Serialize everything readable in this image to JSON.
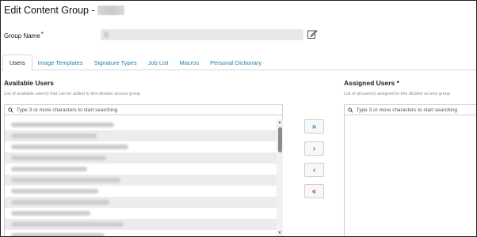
{
  "header": {
    "title": "Edit Content Group -"
  },
  "group_name": {
    "label": "Group Name",
    "required_mark": "*",
    "value": ""
  },
  "tabs": [
    {
      "label": "Users",
      "active": true
    },
    {
      "label": "Image Templates",
      "active": false
    },
    {
      "label": "Signature Types",
      "active": false
    },
    {
      "label": "Job List",
      "active": false
    },
    {
      "label": "Macros",
      "active": false
    },
    {
      "label": "Personal Dictionary",
      "active": false
    }
  ],
  "available": {
    "title": "Available Users",
    "subtitle": "List of available user(s) that can be added to this dictator access group",
    "search_placeholder": "Type 3 or more characters to start searching",
    "rows": 11
  },
  "assigned": {
    "title": "Assigned Users *",
    "subtitle": "List of all user(s) assigned to this dictator access group",
    "search_placeholder": "Type 3 or more characters to start searching"
  },
  "move_buttons": {
    "add_all": "»",
    "add_selected": "›",
    "remove_selected": "‹",
    "remove_all": "«"
  },
  "colors": {
    "link_blue": "#1f7fb0",
    "add_blue": "#1f8fb8",
    "remove_red": "#d23b3b",
    "row_alt": "#ececec"
  }
}
